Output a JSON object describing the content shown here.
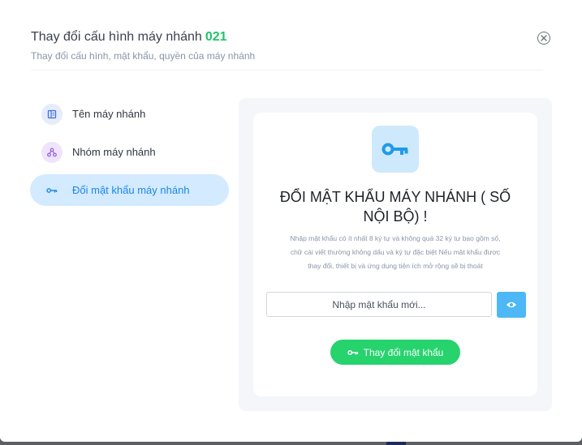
{
  "header": {
    "title": "Thay đổi cấu hình máy nhánh",
    "extension_code": "021",
    "subtitle": "Thay đổi cấu hình, mật khẩu, quyền của máy nhánh"
  },
  "menu": {
    "items": [
      {
        "label": "Tên máy nhánh",
        "icon": "id-card-icon",
        "active": false
      },
      {
        "label": "Nhóm máy nhánh",
        "icon": "group-nodes-icon",
        "active": false
      },
      {
        "label": "Đổi mật khẩu máy nhánh",
        "icon": "key-icon",
        "active": true
      }
    ]
  },
  "card": {
    "title": "ĐỔI MẬT KHẨU MÁY NHÁNH ( SỐ NỘI BỘ) !",
    "description_lines": [
      "Nhập mật khẩu có ít nhất 8 ký tự và không quá 32 ký tự bao gồm số,",
      "chữ cái viết thường không dấu và ký tự đặc biệt Nếu mật khẩu được",
      "thay đổi, thiết bị và ứng dụng tiện ích mở rộng sẽ bị thoát"
    ],
    "password_placeholder": "Nhập mật khẩu mới...",
    "password_value": "",
    "submit_label": "Thay đổi mật khẩu"
  },
  "colors": {
    "accent_green": "#1fc46a",
    "active_blue": "#1c86e8",
    "button_green": "#26d36d",
    "eye_button": "#4db8f5"
  }
}
